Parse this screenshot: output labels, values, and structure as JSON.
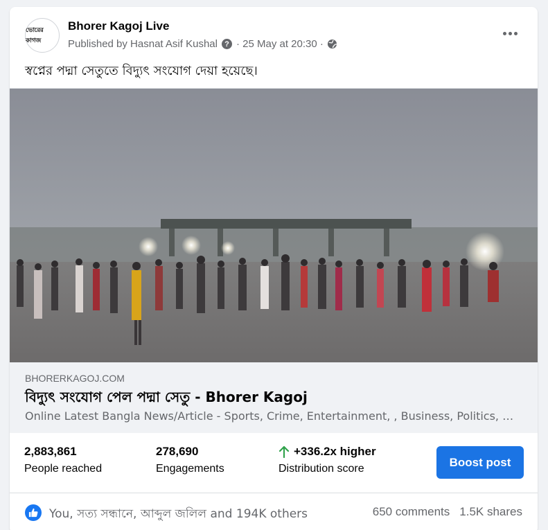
{
  "post": {
    "page_name": "Bhorer Kagoj Live",
    "avatar_text": "ভোরের কাগজ",
    "published_by": "Published by Hasnat Asif Kushal",
    "timestamp": "· 25 May at 20:30 ·",
    "text": "স্বপ্নের পদ্মা সেতুতে বিদ্যুৎ সংযোগ দেয়া হয়েছে।"
  },
  "link_preview": {
    "domain": "BHORERKAGOJ.COM",
    "title": "বিদ্যুৎ সংযোগ পেল পদ্মা সেতু - Bhorer Kagoj",
    "description": "Online Latest Bangla News/Article - Sports, Crime, Entertainment, , Business, Politics, Education, Opinion, Lifestyle"
  },
  "insights": {
    "people_reached": {
      "value": "2,883,861",
      "label": "People reached"
    },
    "engagements": {
      "value": "278,690",
      "label": "Engagements"
    },
    "distribution": {
      "value": "+336.2x higher",
      "label": "Distribution score",
      "color": "#31a24c"
    },
    "boost_label": "Boost post",
    "boost_color": "#1b74e4"
  },
  "footer": {
    "reactions_text": "You, সত্য সন্ধানে, আব্দুল জলিল and 194K others",
    "comments": "650 comments",
    "shares": "1.5K shares"
  }
}
